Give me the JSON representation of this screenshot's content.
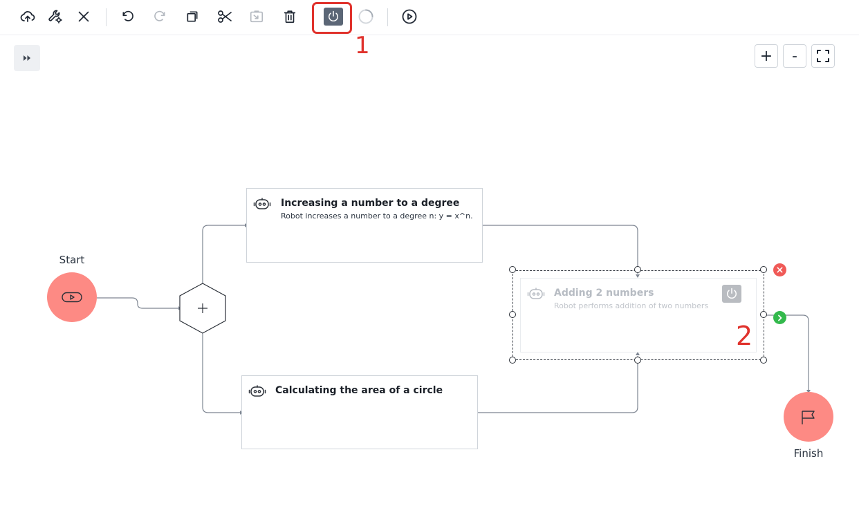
{
  "toolbar": {
    "buttons": [
      {
        "name": "save-to-cloud",
        "icon": "cloud-upload-icon"
      },
      {
        "name": "settings",
        "icon": "wrench-gear-icon"
      },
      {
        "name": "close",
        "icon": "close-icon"
      },
      {
        "name": "undo",
        "icon": "undo-icon"
      },
      {
        "name": "redo",
        "icon": "redo-icon",
        "disabled": true
      },
      {
        "name": "copy",
        "icon": "copy-icon"
      },
      {
        "name": "cut",
        "icon": "scissors-icon"
      },
      {
        "name": "paste",
        "icon": "paste-icon",
        "disabled": true
      },
      {
        "name": "delete",
        "icon": "trash-icon"
      },
      {
        "name": "toggle-disable",
        "icon": "power-icon",
        "active": true
      },
      {
        "name": "loading",
        "icon": "spinner-icon"
      },
      {
        "name": "run",
        "icon": "play-circle-icon"
      }
    ]
  },
  "annotations": {
    "one": "1",
    "two": "2"
  },
  "zoom": {
    "in": "+",
    "out": "-"
  },
  "flow": {
    "start_label": "Start",
    "finish_label": "Finish",
    "cards": [
      {
        "title": "Increasing a number to a degree",
        "description": "Robot increases a number to a degree n: y = x^n."
      },
      {
        "title": "Calculating the area of a circle",
        "description": ""
      },
      {
        "title": "Adding 2 numbers",
        "description": "Robot performs addition of two numbers",
        "disabled": true,
        "selected": true
      }
    ]
  },
  "colors": {
    "node_fill": "#fd8a84",
    "annotation": "#e0322c",
    "selected_power_bg": "#5b6676",
    "remove": "#f05a57",
    "next": "#33b94c"
  }
}
